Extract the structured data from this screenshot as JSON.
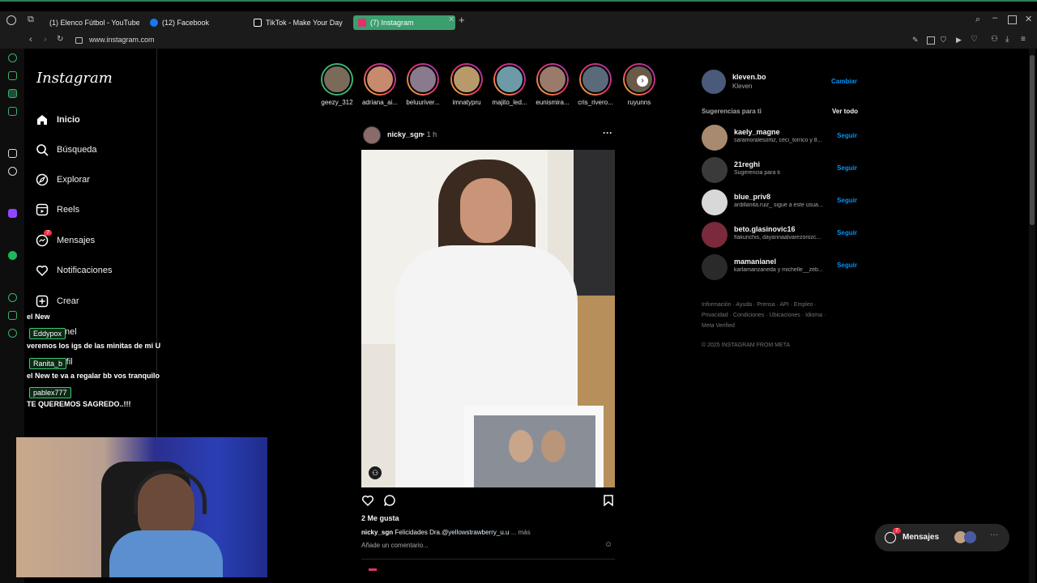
{
  "browser": {
    "tabs": [
      {
        "label": "(1) Elenco Fútbol - YouTube",
        "icon": "youtube-icon",
        "color": "#ff0000"
      },
      {
        "label": "(12) Facebook",
        "icon": "facebook-icon",
        "color": "#1877f2"
      },
      {
        "label": "TikTok - Make Your Day",
        "icon": "tiktok-icon",
        "color": "#ffffff"
      },
      {
        "label": "(7) Instagram",
        "icon": "instagram-icon",
        "color": "#e1306c"
      }
    ],
    "url": "www.instagram.com",
    "accent": "#3b9e6e"
  },
  "nav": {
    "logo": "Instagram",
    "items": [
      {
        "label": "Inicio",
        "icon": "home-icon"
      },
      {
        "label": "Búsqueda",
        "icon": "search-icon"
      },
      {
        "label": "Explorar",
        "icon": "compass-icon"
      },
      {
        "label": "Reels",
        "icon": "reels-icon"
      },
      {
        "label": "Mensajes",
        "icon": "messenger-icon",
        "badge": "7"
      },
      {
        "label": "Notificaciones",
        "icon": "heart-icon"
      },
      {
        "label": "Crear",
        "icon": "plus-icon"
      },
      {
        "label": "nel",
        "icon": "profile-icon"
      },
      {
        "label": "rfil",
        "icon": "profile-icon"
      }
    ]
  },
  "chat": [
    {
      "name": "",
      "message": "el New"
    },
    {
      "name": "Eddypox",
      "message": "veremos los igs de las minitas de mi U"
    },
    {
      "name": "Ranita_b",
      "message": "el New te va a regalar bb vos tranquilo"
    },
    {
      "name": "pablex777",
      "message": "TE QUEREMOS SAGREDO..!!!"
    }
  ],
  "stories": [
    {
      "name": "geezy_312",
      "seen": true,
      "color": "#7a6a5a"
    },
    {
      "name": "adriana_ai...",
      "seen": false,
      "color": "#c78a6e"
    },
    {
      "name": "beluuriver...",
      "seen": false,
      "color": "#8a7a8e"
    },
    {
      "name": "imnatypru",
      "seen": false,
      "color": "#b89a6a"
    },
    {
      "name": "majito_led...",
      "seen": false,
      "color": "#6e9aa8"
    },
    {
      "name": "eunismira...",
      "seen": false,
      "color": "#9a7a6a"
    },
    {
      "name": "cris_rivero...",
      "seen": false,
      "color": "#5a6a7a"
    },
    {
      "name": "ruyunns",
      "seen": false,
      "color": "#6a5a4a"
    }
  ],
  "post": {
    "username": "nicky_sgn",
    "time": "• 1 h",
    "likes": "2 Me gusta",
    "caption_user": "nicky_sgn",
    "caption_text": "Felicidades Dra.",
    "caption_mention": "@yellowstrawberry_u.u",
    "caption_more": "... más",
    "comment_placeholder": "Añade un comentario..."
  },
  "account": {
    "username": "kleven.bo",
    "name": "Kleven",
    "switch_label": "Cambiar"
  },
  "suggestions": {
    "title": "Sugerencias para ti",
    "see_all": "Ver todo",
    "follow_label": "Seguir",
    "items": [
      {
        "username": "kaely_magne",
        "sub": "saramoralesortiz, ceci_torrico y 8...",
        "color": "#a88a70"
      },
      {
        "username": "21reghi",
        "sub": "Sugerencia para ti",
        "color": "#3a3a3a"
      },
      {
        "username": "blue_priv8",
        "sub": "ardillanita.ruiz_ sigue a este usua...",
        "color": "#d8d8d8"
      },
      {
        "username": "beto.glasinovic16",
        "sub": "flakunchis, dayannaalvarezorozc...",
        "color": "#7a2a3a"
      },
      {
        "username": "mamanianel",
        "sub": "karlamanzaneda y michelle__zeb...",
        "color": "#2a2a2a"
      }
    ]
  },
  "footer": {
    "line1": "Información · Ayuda · Prensa · API · Empleo ·",
    "line2": "Privacidad · Condiciones · Ubicaciones · Idioma ·",
    "line3": "Meta Verified",
    "copyright": "© 2025 INSTAGRAM FROM META"
  },
  "messages_button": {
    "label": "Mensajes",
    "badge": "7"
  }
}
